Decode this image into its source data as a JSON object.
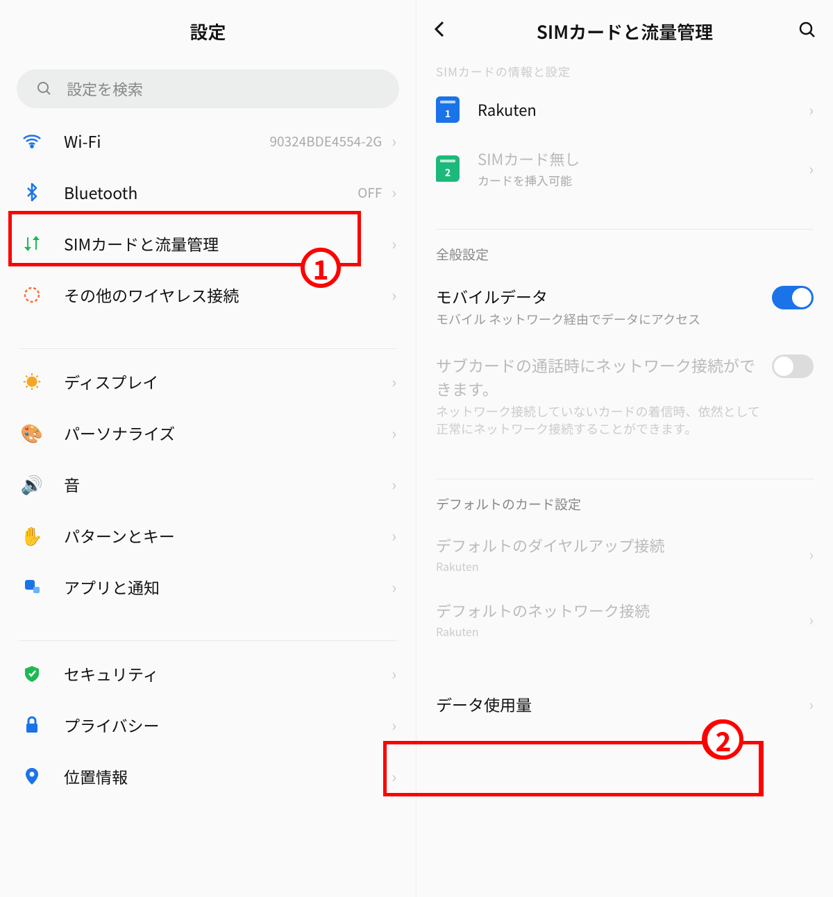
{
  "left": {
    "title": "設定",
    "search_placeholder": "設定を検索",
    "items": [
      {
        "icon": "wifi",
        "label": "Wi-Fi",
        "hint": "90324BDE4554-2G"
      },
      {
        "icon": "bluetooth",
        "label": "Bluetooth",
        "hint": "OFF"
      },
      {
        "icon": "sim",
        "label": "SIMカードと流量管理",
        "hint": ""
      },
      {
        "icon": "wireless",
        "label": "その他のワイヤレス接続",
        "hint": ""
      }
    ],
    "items2": [
      {
        "icon": "display",
        "label": "ディスプレイ"
      },
      {
        "icon": "personalize",
        "label": "パーソナライズ"
      },
      {
        "icon": "sound",
        "label": "音"
      },
      {
        "icon": "pattern",
        "label": "パターンとキー"
      },
      {
        "icon": "apps",
        "label": "アプリと通知"
      }
    ],
    "items3": [
      {
        "icon": "security",
        "label": "セキュリティ"
      },
      {
        "icon": "privacy",
        "label": "プライバシー"
      },
      {
        "icon": "location",
        "label": "位置情報"
      }
    ]
  },
  "right": {
    "title": "SIMカードと流量管理",
    "header_cutoff": "SIMカードの情報と設定",
    "sim1": {
      "label": "Rakuten",
      "num": "1"
    },
    "sim2": {
      "label": "SIMカード無し",
      "sub": "カードを挿入可能",
      "num": "2"
    },
    "general_header": "全般設定",
    "mobile_data": {
      "title": "モバイルデータ",
      "sub": "モバイル ネットワーク経由でデータにアクセス"
    },
    "subcard": {
      "title": "サブカードの通話時にネットワーク接続ができます。",
      "sub": "ネットワーク接続していないカードの着信時、依然として正常にネットワーク接続することができます。"
    },
    "default_header": "デフォルトのカード設定",
    "default_dial": {
      "title": "デフォルトのダイヤルアップ接続",
      "sub": "Rakuten"
    },
    "default_net": {
      "title": "デフォルトのネットワーク接続",
      "sub": "Rakuten"
    },
    "data_usage": "データ使用量"
  },
  "annotations": {
    "one": "1",
    "two": "2"
  }
}
